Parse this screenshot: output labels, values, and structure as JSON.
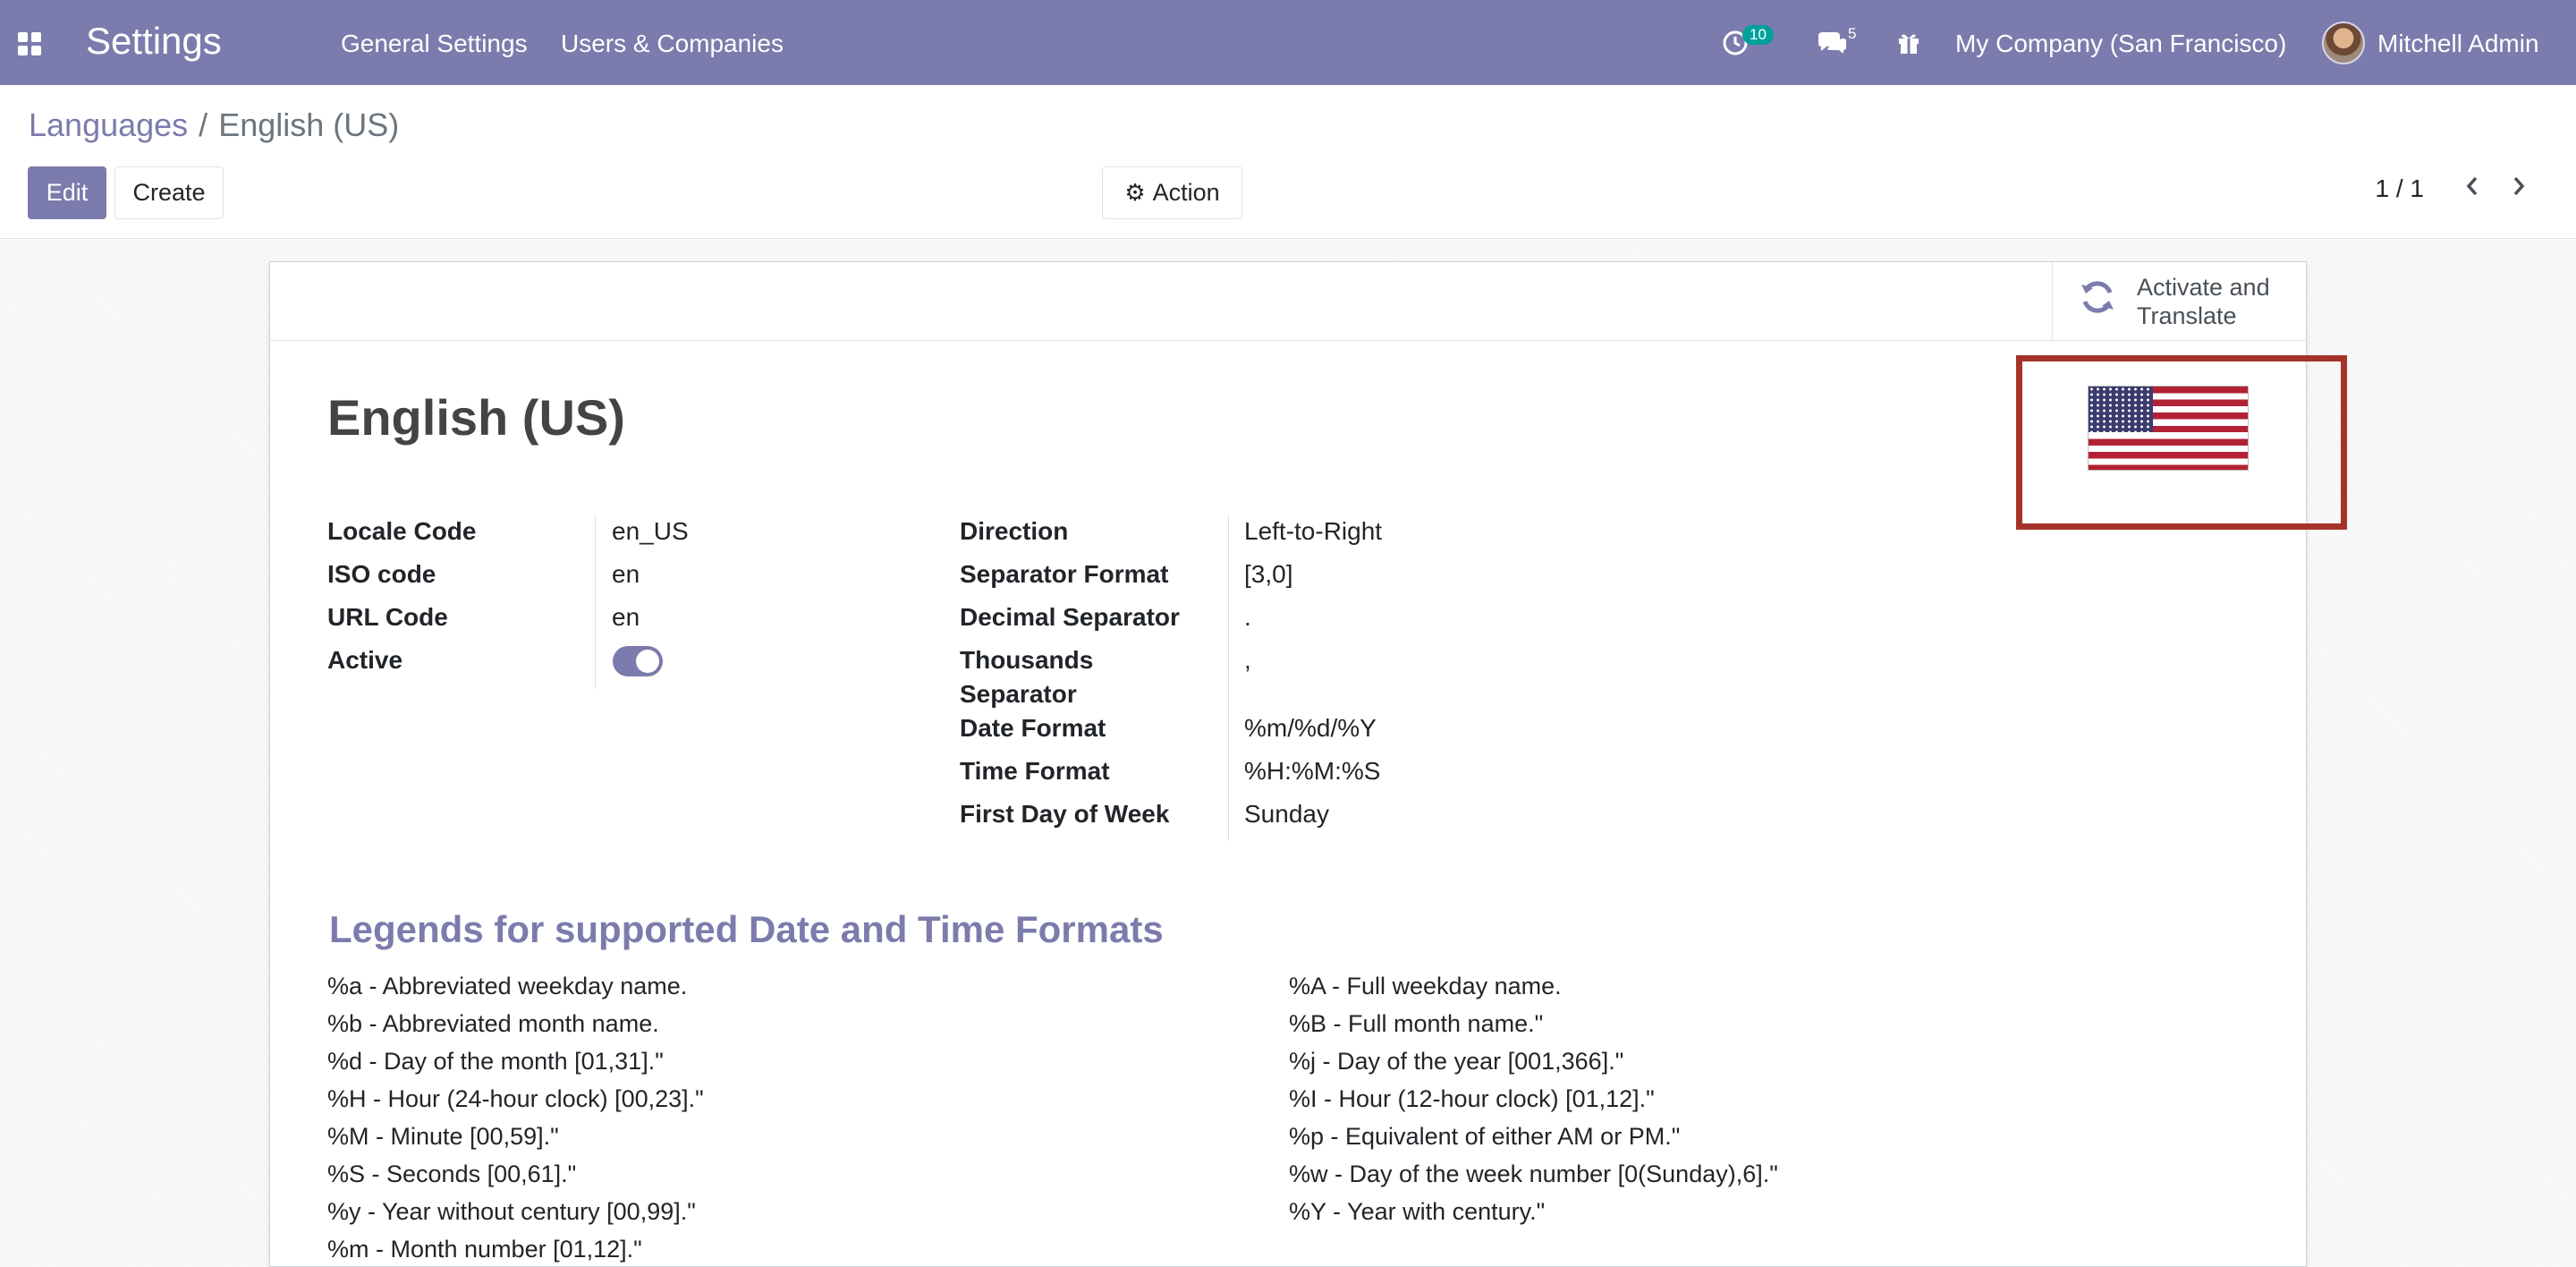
{
  "navbar": {
    "brand": "Settings",
    "menu": [
      "General Settings",
      "Users & Companies"
    ],
    "activity_count": "10",
    "messages_count": "5",
    "company": "My Company (San Francisco)",
    "user": "Mitchell Admin"
  },
  "breadcrumb": {
    "parent": "Languages",
    "separator": "/",
    "current": "English (US)"
  },
  "buttons": {
    "edit": "Edit",
    "create": "Create",
    "action": "Action"
  },
  "pager": {
    "value": "1 / 1"
  },
  "stat_button": {
    "line1": "Activate and",
    "line2": "Translate"
  },
  "record": {
    "title": "English (US)"
  },
  "fields_left": [
    {
      "label": "Locale Code",
      "value": "en_US"
    },
    {
      "label": "ISO code",
      "value": "en"
    },
    {
      "label": "URL Code",
      "value": "en"
    },
    {
      "label": "Active",
      "value": "on"
    }
  ],
  "fields_right": [
    {
      "label": "Direction",
      "value": "Left-to-Right"
    },
    {
      "label": "Separator Format",
      "value": "[3,0]"
    },
    {
      "label": "Decimal Separator",
      "value": "."
    },
    {
      "label_line1": "Thousands",
      "label_line2": "Separator",
      "value": ","
    },
    {
      "label": "Date Format",
      "value": "%m/%d/%Y"
    },
    {
      "label": "Time Format",
      "value": "%H:%M:%S"
    },
    {
      "label": "First Day of Week",
      "value": "Sunday"
    }
  ],
  "legend": {
    "title": "Legends for supported Date and Time Formats",
    "left": [
      "%a - Abbreviated weekday name.",
      "%b - Abbreviated month name.",
      "%d - Day of the month [01,31].\"",
      "%H - Hour (24-hour clock) [00,23].\"",
      "%M - Minute [00,59].\"",
      "%S - Seconds [00,61].\"",
      "%y - Year without century [00,99].\"",
      "%m - Month number [01,12].\""
    ],
    "right": [
      "%A - Full weekday name.",
      "%B - Full month name.\"",
      "%j - Day of the year [001,366].\"",
      "%I - Hour (12-hour clock) [01,12].\"",
      "%p - Equivalent of either AM or PM.\"",
      "%w - Day of the week number [0(Sunday),6].\"",
      "%Y - Year with century.\""
    ]
  },
  "colors": {
    "brand": "#7c7bad",
    "highlight": "#a6332a",
    "toggle_on": "#7c7bad"
  },
  "icons": [
    "apps-icon",
    "activity-clock-icon",
    "chat-icon",
    "gift-icon",
    "refresh-icon",
    "gear-icon",
    "chevron-left-icon",
    "chevron-right-icon",
    "flag-us-icon"
  ]
}
